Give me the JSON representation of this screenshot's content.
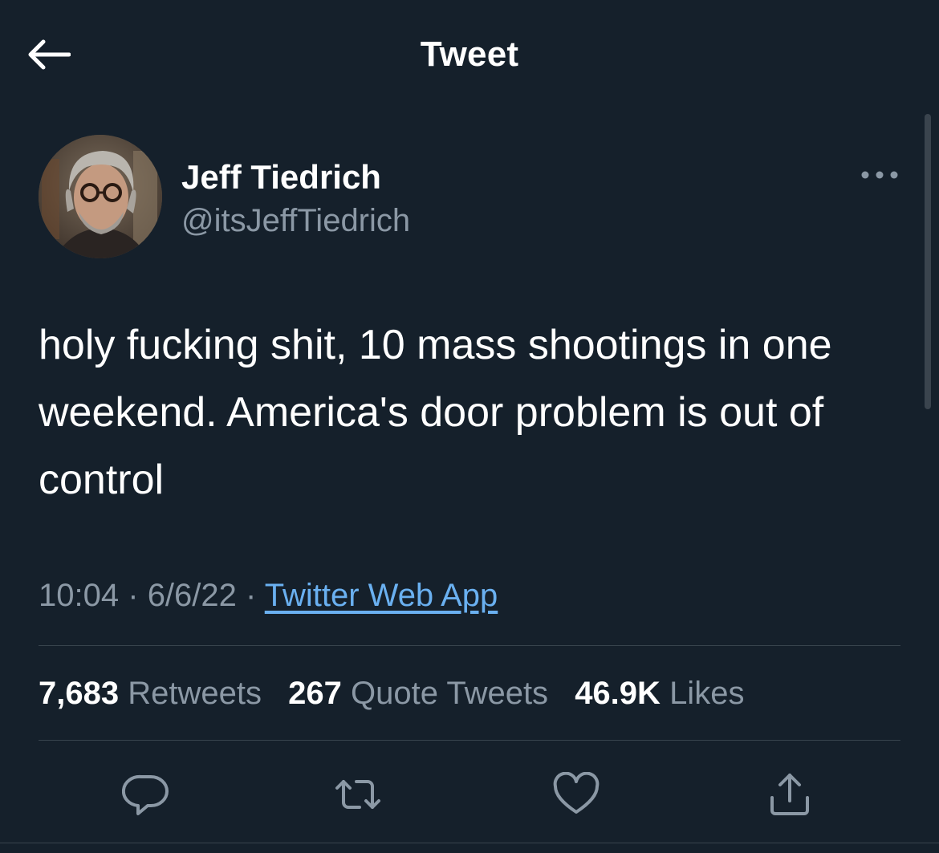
{
  "header": {
    "title": "Tweet",
    "back_icon": "arrow-left-icon"
  },
  "tweet": {
    "author": {
      "name": "Jeff Tiedrich",
      "handle": "@itsJeffTiedrich"
    },
    "more_icon": "more-horizontal-icon",
    "text": "holy fucking shit, 10 mass shootings in one weekend. America's door problem is out of control",
    "time": "10:04",
    "date": "6/6/22",
    "separator": "·",
    "source": "Twitter Web App",
    "stats": {
      "retweets_count": "7,683",
      "retweets_label": "Retweets",
      "quotes_count": "267",
      "quotes_label": "Quote Tweets",
      "likes_count": "46.9K",
      "likes_label": "Likes"
    },
    "actions": [
      {
        "name": "reply",
        "icon": "reply-icon"
      },
      {
        "name": "retweet",
        "icon": "retweet-icon"
      },
      {
        "name": "like",
        "icon": "heart-icon"
      },
      {
        "name": "share",
        "icon": "share-icon"
      }
    ]
  },
  "colors": {
    "background": "#15202b",
    "text_primary": "#ffffff",
    "text_secondary": "#8b98a5",
    "link": "#6ab0f0",
    "divider": "#38444d"
  }
}
